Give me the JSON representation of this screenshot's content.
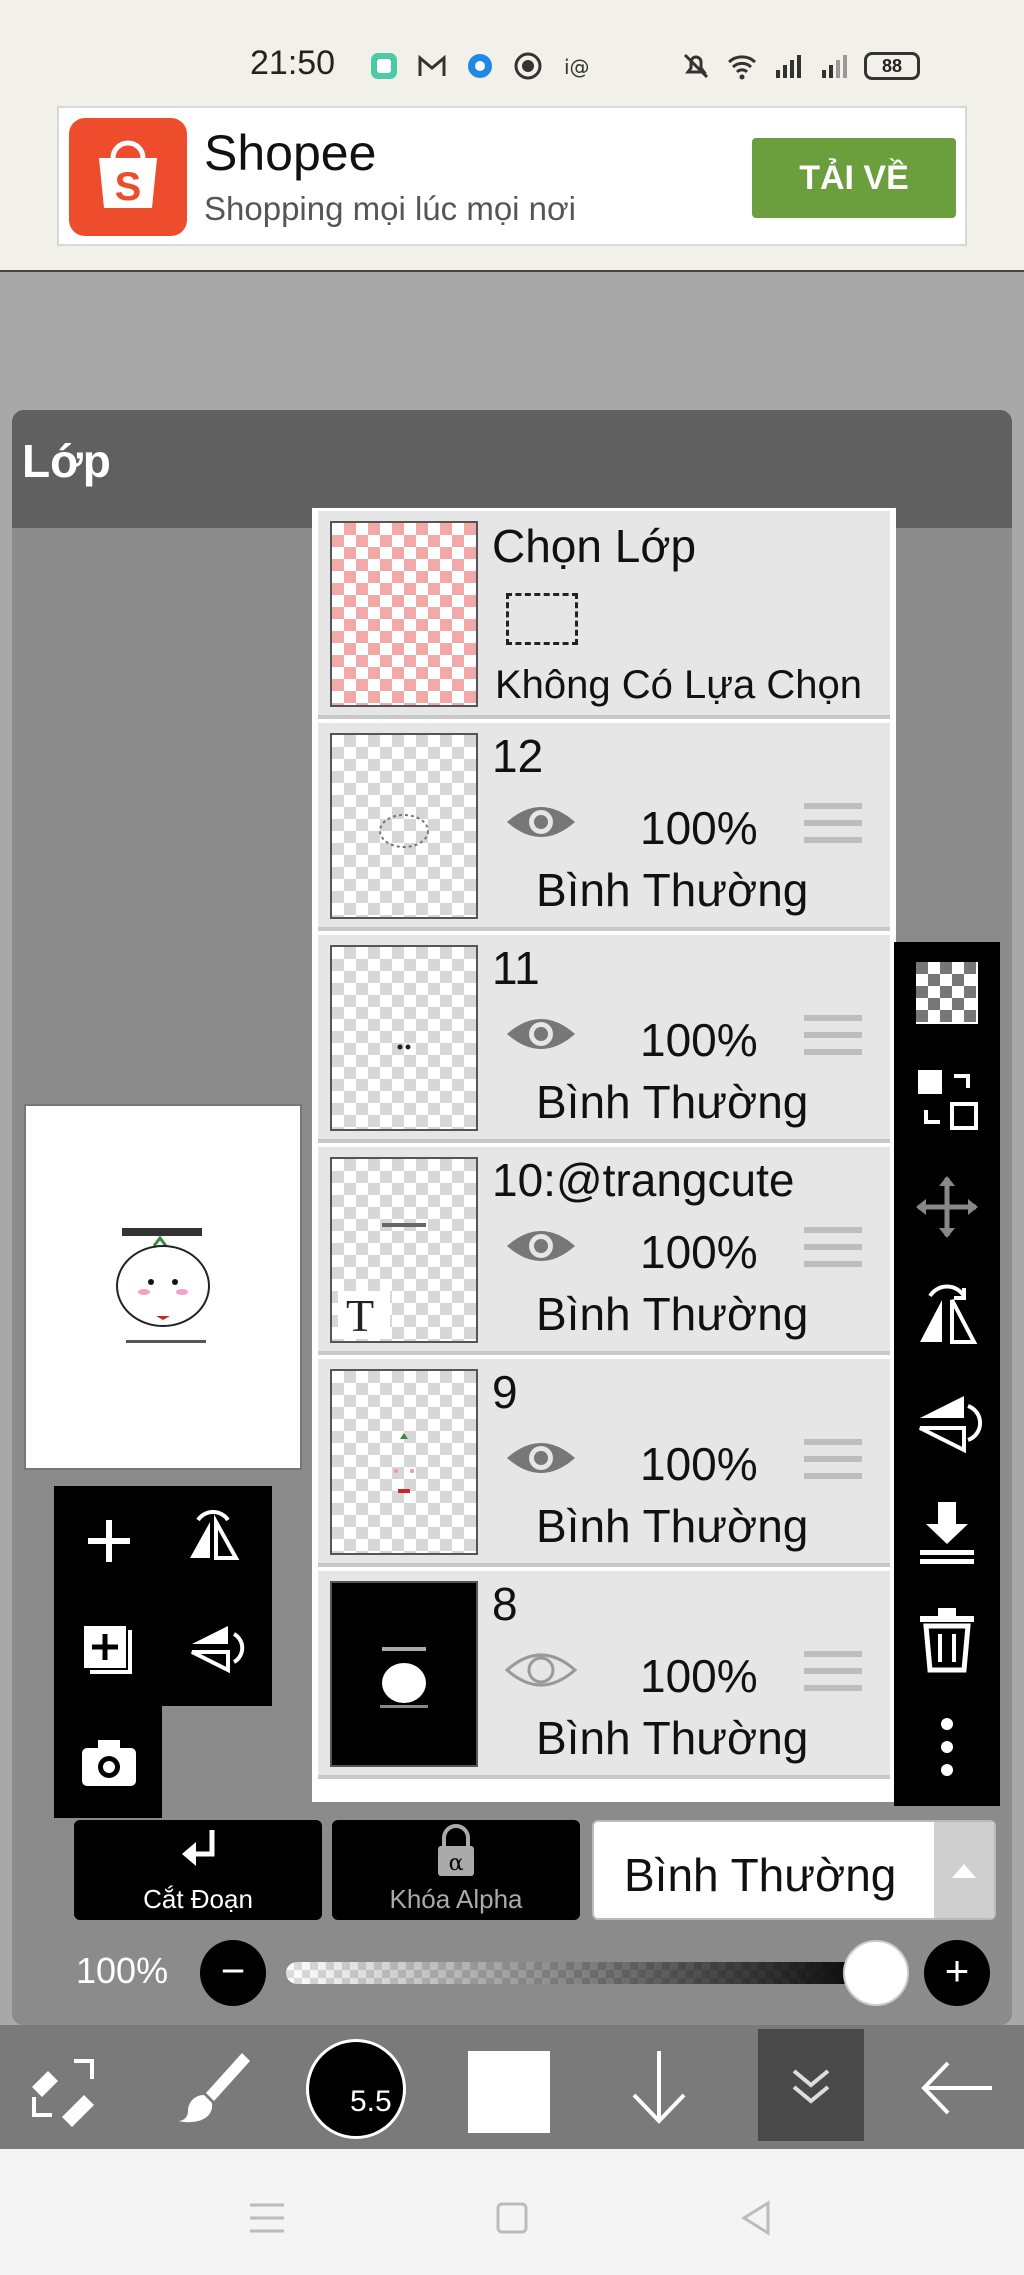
{
  "status_bar": {
    "time": "21:50",
    "battery": "88"
  },
  "ad": {
    "title": "Shopee",
    "subtitle": "Shopping mọi lúc mọi nơi",
    "button": "TẢI VỀ",
    "brand_color": "#ee4d2d",
    "button_color": "#6b9e3c"
  },
  "panel": {
    "title": "Lớp"
  },
  "selection_layer": {
    "name": "Chọn Lớp",
    "status": "Không Có Lựa Chọn"
  },
  "layers": [
    {
      "name": "12",
      "opacity": "100%",
      "blend": "Bình Thường",
      "visible": true
    },
    {
      "name": "11",
      "opacity": "100%",
      "blend": "Bình Thường",
      "visible": true
    },
    {
      "name": "10:@trangcute",
      "opacity": "100%",
      "blend": "Bình Thường",
      "visible": true
    },
    {
      "name": "9",
      "opacity": "100%",
      "blend": "Bình Thường",
      "visible": true
    },
    {
      "name": "8",
      "opacity": "100%",
      "blend": "Bình Thường",
      "visible": false
    }
  ],
  "controls": {
    "clip_label": "Cắt Đoạn",
    "alpha_lock_label": "Khóa Alpha",
    "blend_mode": "Bình Thường",
    "opacity_label": "100%",
    "opacity_value": 1.0
  },
  "bottom_toolbar": {
    "brush_size": "5.5"
  },
  "icons": {
    "right_toolbar": [
      "checker-icon",
      "move-layer-icon",
      "transform-icon",
      "flip-horizontal-icon",
      "flip-vertical-icon",
      "merge-down-icon",
      "trash-icon",
      "more-icon"
    ],
    "left_toolbar": [
      "add-layer-icon",
      "flip-h-icon",
      "add-copy-icon",
      "flip-v-icon",
      "camera-icon"
    ]
  }
}
